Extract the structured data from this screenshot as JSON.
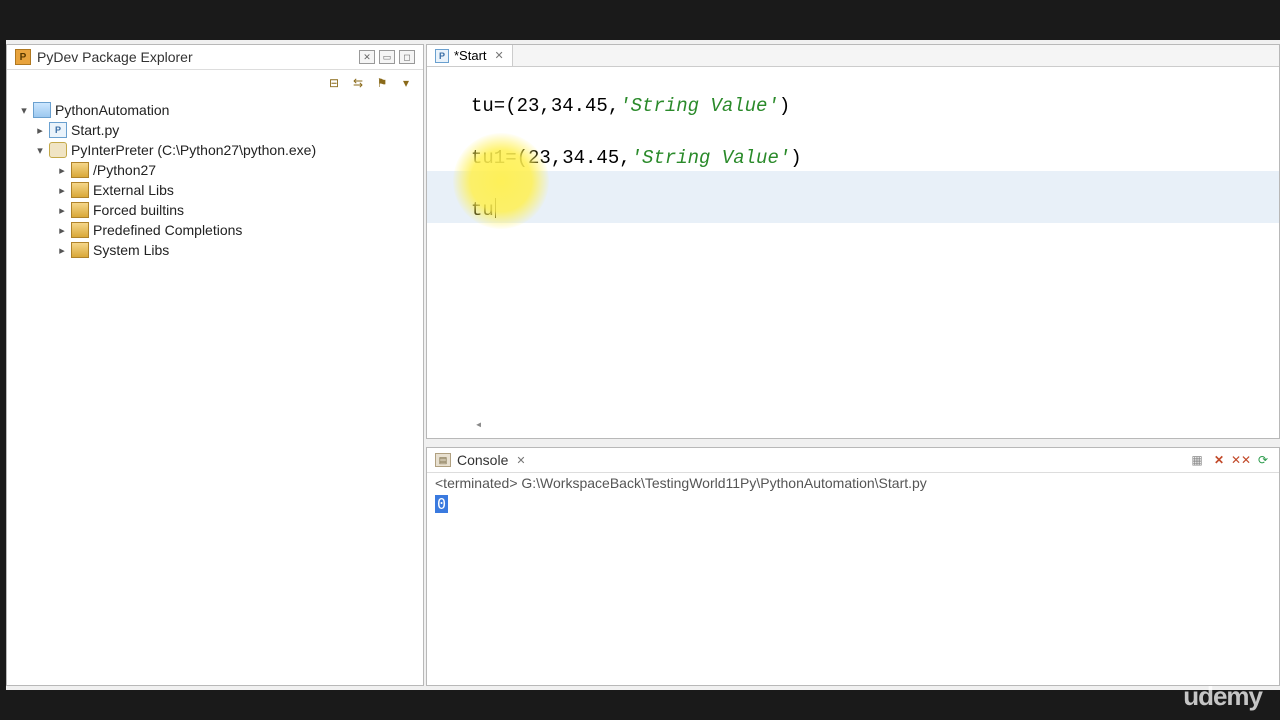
{
  "explorer": {
    "title": "PyDev Package Explorer",
    "tree": {
      "project": "PythonAutomation",
      "file": "Start.py",
      "interpreter_label": "PyInterPreter",
      "interpreter_path": "(C:\\Python27\\python.exe)",
      "libs": [
        "/Python27",
        "External Libs",
        "Forced builtins",
        "Predefined Completions",
        "System Libs"
      ]
    }
  },
  "editor": {
    "tab_label": "*Start",
    "code": {
      "line1_pre": "tu=(",
      "line1_nums": "23,34.45,",
      "line1_str": "'String Value'",
      "line1_post": ")",
      "line2_pre": "tu1=(",
      "line2_nums": "23,34.45,",
      "line2_str": "'String Value'",
      "line2_post": ")",
      "line3": "tu"
    }
  },
  "console": {
    "title": "Console",
    "status_pre": "<terminated> ",
    "status_path": "G:\\WorkspaceBack\\TestingWorld11Py\\PythonAutomation\\Start.py",
    "output": "0"
  },
  "watermark": "udemy"
}
